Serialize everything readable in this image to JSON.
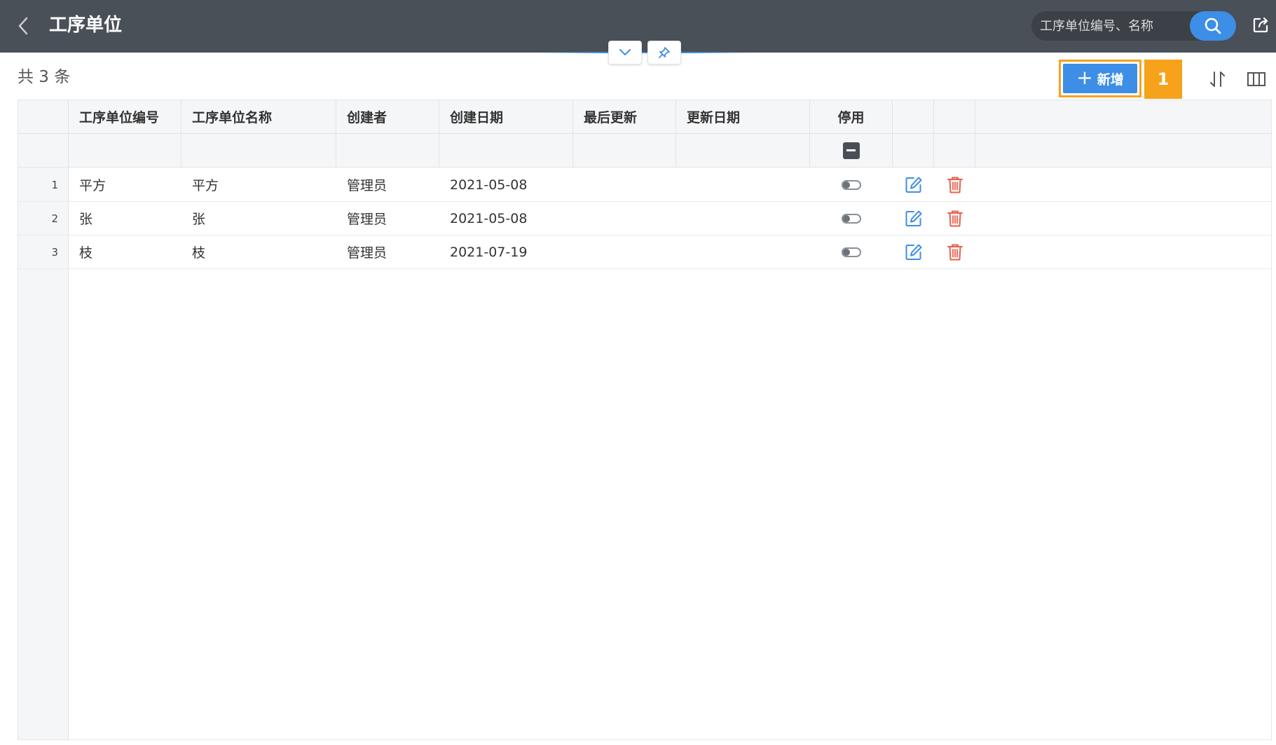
{
  "header": {
    "title": "工序单位",
    "back_icon": "chevron-left-icon",
    "search_placeholder": "工序单位编号、名称",
    "search_value": "",
    "search_icon": "search-icon",
    "export_icon": "external-link-icon"
  },
  "toolbar": {
    "count_text": "共 3 条",
    "add_label": "新增",
    "marker_label": "1",
    "sort_icon": "sort-icon",
    "columns_icon": "columns-icon",
    "collapse_icon": "chevron-down-icon",
    "pin_icon": "pin-icon"
  },
  "table": {
    "columns": [
      "工序单位编号",
      "工序单位名称",
      "创建者",
      "创建日期",
      "最后更新",
      "更新日期",
      "停用"
    ],
    "rows": [
      {
        "index": "1",
        "code": "平方",
        "name": "平方",
        "creator": "管理员",
        "created": "2021-05-08",
        "last_updated": "",
        "updated": "",
        "disabled": false
      },
      {
        "index": "2",
        "code": "张",
        "name": "张",
        "creator": "管理员",
        "created": "2021-05-08",
        "last_updated": "",
        "updated": "",
        "disabled": false
      },
      {
        "index": "3",
        "code": "枝",
        "name": "枝",
        "creator": "管理员",
        "created": "2021-07-19",
        "last_updated": "",
        "updated": "",
        "disabled": false
      }
    ]
  },
  "colors": {
    "header_bg": "#4a5058",
    "accent": "#3d8ee6",
    "highlight": "#f7a21b",
    "delete": "#e8604c"
  }
}
